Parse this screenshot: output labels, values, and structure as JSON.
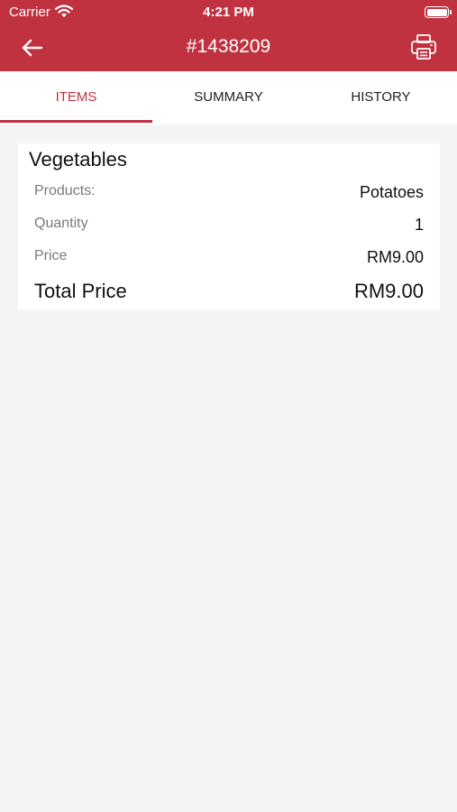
{
  "status_bar": {
    "carrier": "Carrier",
    "time": "4:21 PM"
  },
  "nav": {
    "title": "#1438209",
    "back_icon": "arrow-left-icon",
    "print_icon": "printer-icon"
  },
  "tabs": [
    {
      "label": "ITEMS",
      "active": true
    },
    {
      "label": "SUMMARY",
      "active": false
    },
    {
      "label": "HISTORY",
      "active": false
    }
  ],
  "item": {
    "category": "Vegetables",
    "rows": [
      {
        "label": "Products:",
        "value": "Potatoes"
      },
      {
        "label": "Quantity",
        "value": "1"
      },
      {
        "label": "Price",
        "value": "RM9.00"
      }
    ],
    "total_label": "Total Price",
    "total_value": "RM9.00"
  },
  "colors": {
    "brand": "#c13241",
    "background": "#f4f4f4"
  }
}
